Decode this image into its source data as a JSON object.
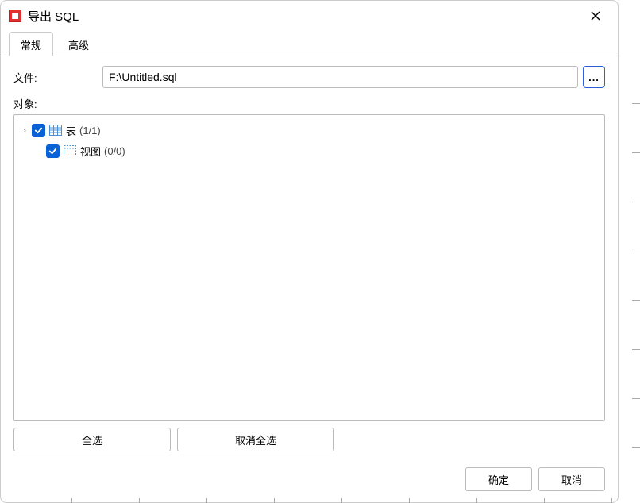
{
  "title": "导出 SQL",
  "tabs": {
    "general": "常规",
    "advanced": "高级"
  },
  "labels": {
    "file": "文件:",
    "objects": "对象:"
  },
  "file": {
    "value": "F:\\Untitled.sql",
    "browse": "..."
  },
  "tree": {
    "tables": {
      "label": "表",
      "count": "(1/1)"
    },
    "views": {
      "label": "视图",
      "count": "(0/0)"
    }
  },
  "buttons": {
    "select_all": "全选",
    "deselect_all": "取消全选",
    "ok": "确定",
    "cancel": "取消"
  }
}
